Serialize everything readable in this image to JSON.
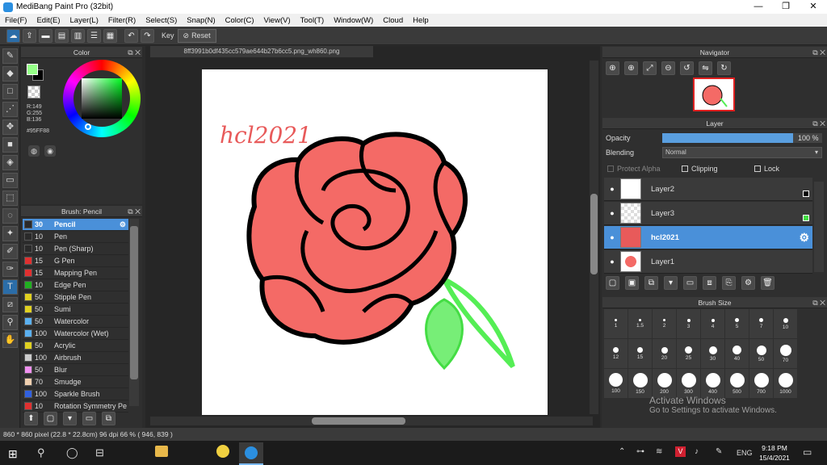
{
  "window": {
    "title": "MediBang Paint Pro (32bit)",
    "minimize": "—",
    "restore": "❐",
    "close": "✕"
  },
  "menu": [
    "File(F)",
    "Edit(E)",
    "Layer(L)",
    "Filter(R)",
    "Select(S)",
    "Snap(N)",
    "Color(C)",
    "View(V)",
    "Tool(T)",
    "Window(W)",
    "Cloud",
    "Help"
  ],
  "toolbar": {
    "key_label": "Key",
    "reset_label": "Reset"
  },
  "color_panel": {
    "title": "Color",
    "r": "R:149",
    "g": "G:255",
    "b": "B:136",
    "hex": "#95FF88",
    "fg_color": "#95FF88",
    "bg_color": "#000000"
  },
  "brush_panel": {
    "title": "Brush: Pencil",
    "items": [
      {
        "size": "30",
        "name": "Pencil",
        "color": "#2a2a2a",
        "selected": true
      },
      {
        "size": "10",
        "name": "Pen",
        "color": "#2a2a2a"
      },
      {
        "size": "10",
        "name": "Pen (Sharp)",
        "color": "#2a2a2a"
      },
      {
        "size": "15",
        "name": "G Pen",
        "color": "#e03030"
      },
      {
        "size": "15",
        "name": "Mapping Pen",
        "color": "#e03030"
      },
      {
        "size": "10",
        "name": "Edge Pen",
        "color": "#20b020"
      },
      {
        "size": "50",
        "name": "Stipple Pen",
        "color": "#e0d020"
      },
      {
        "size": "50",
        "name": "Sumi",
        "color": "#e0d020"
      },
      {
        "size": "50",
        "name": "Watercolor",
        "color": "#5ab0f0"
      },
      {
        "size": "100",
        "name": "Watercolor (Wet)",
        "color": "#5ab0f0"
      },
      {
        "size": "50",
        "name": "Acrylic",
        "color": "#e0d020"
      },
      {
        "size": "100",
        "name": "Airbrush",
        "color": "#cccccc"
      },
      {
        "size": "50",
        "name": "Blur",
        "color": "#f090f0"
      },
      {
        "size": "70",
        "name": "Smudge",
        "color": "#f0d0b0"
      },
      {
        "size": "100",
        "name": "Sparkle Brush",
        "color": "#3060e0"
      },
      {
        "size": "10",
        "name": "Rotation Symmetry Pe",
        "color": "#e03030"
      }
    ]
  },
  "document": {
    "tab_title": "8ff3991b0df435cc579ae644b27b6cc5.png_wh860.png",
    "text": "hcl2021"
  },
  "navigator": {
    "title": "Navigator"
  },
  "layer_panel": {
    "title": "Layer",
    "opacity_label": "Opacity",
    "opacity_value": "100 %",
    "opacity_fraction": 1.0,
    "blending_label": "Blending",
    "blending_value": "Normal",
    "protect_alpha": "Protect Alpha",
    "clipping": "Clipping",
    "lock": "Lock",
    "layers": [
      {
        "name": "Layer2",
        "selected": false
      },
      {
        "name": "Layer3",
        "selected": false
      },
      {
        "name": "hcl2021",
        "selected": true
      },
      {
        "name": "Layer1",
        "selected": false
      }
    ]
  },
  "brush_size_panel": {
    "title": "Brush Size",
    "sizes": [
      "1",
      "1.5",
      "2",
      "3",
      "4",
      "5",
      "7",
      "10",
      "12",
      "15",
      "20",
      "25",
      "30",
      "40",
      "50",
      "70",
      "100",
      "150",
      "200",
      "300",
      "400",
      "500",
      "700",
      "1000"
    ]
  },
  "status": {
    "text": "860 * 860 pixel  (22.8 * 22.8cm)  96 dpi  66 %  ( 946, 839 )"
  },
  "watermark": {
    "line1": "Activate Windows",
    "line2": "Go to Settings to activate Windows."
  },
  "taskbar": {
    "lang": "ENG",
    "time": "9:18 PM",
    "date": "15/4/2021"
  }
}
